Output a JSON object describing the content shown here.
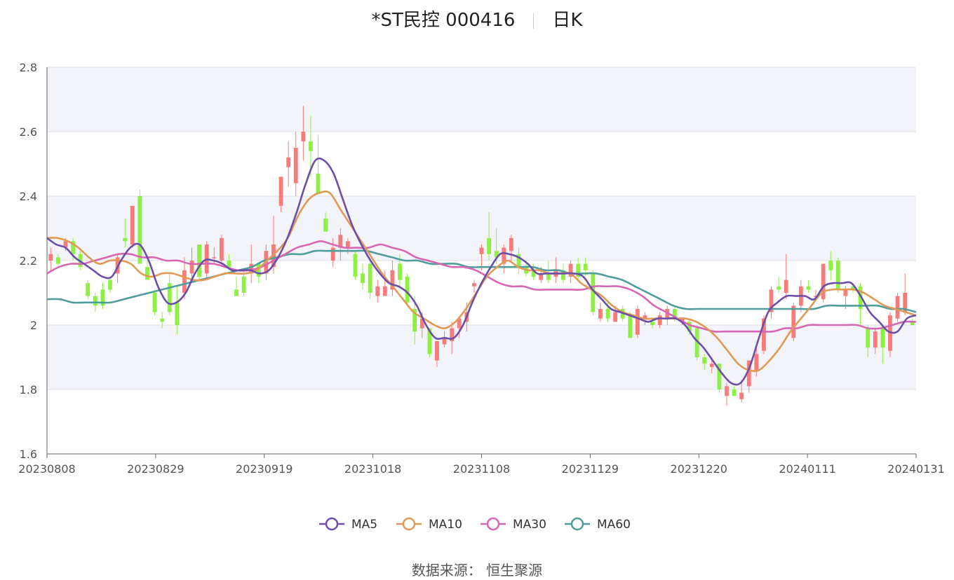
{
  "header": {
    "stock": "*ST民控 000416",
    "period": "日K"
  },
  "source": "数据来源： 恒生聚源",
  "colors": {
    "up": "#f87b7b",
    "down": "#8ef044",
    "ma5": "#6d4fa8",
    "ma10": "#e09a55",
    "ma30": "#d866b2",
    "ma60": "#4f9e9a",
    "grid": "#dde1ea",
    "band": "#f3f4f9"
  },
  "chart_data": {
    "type": "candlestick",
    "ylim": [
      1.6,
      2.8
    ],
    "yticks": [
      "1.6",
      "1.8",
      "2",
      "2.2",
      "2.4",
      "2.6",
      "2.8"
    ],
    "xticks": [
      "20230808",
      "20230829",
      "20230919",
      "20231018",
      "20231108",
      "20231129",
      "20231220",
      "20240111",
      "20240131"
    ],
    "legend": [
      "MA5",
      "MA10",
      "MA30",
      "MA60"
    ],
    "candles": [
      [
        2.2,
        2.22,
        2.17,
        2.24
      ],
      [
        2.21,
        2.19,
        2.18,
        2.22
      ],
      [
        2.24,
        2.26,
        2.23,
        2.27
      ],
      [
        2.26,
        2.22,
        2.2,
        2.27
      ],
      [
        2.22,
        2.18,
        2.17,
        2.23
      ],
      [
        2.13,
        2.09,
        2.08,
        2.14
      ],
      [
        2.09,
        2.06,
        2.04,
        2.1
      ],
      [
        2.11,
        2.06,
        2.05,
        2.13
      ],
      [
        2.14,
        2.11,
        2.1,
        2.15
      ],
      [
        2.16,
        2.21,
        2.13,
        2.22
      ],
      [
        2.27,
        2.26,
        2.24,
        2.33
      ],
      [
        2.25,
        2.37,
        2.24,
        2.37
      ],
      [
        2.4,
        2.19,
        2.19,
        2.42
      ],
      [
        2.18,
        2.14,
        2.14,
        2.2
      ],
      [
        2.1,
        2.04,
        2.03,
        2.11
      ],
      [
        2.02,
        2.01,
        1.99,
        2.04
      ],
      [
        2.13,
        2.04,
        2.03,
        2.16
      ],
      [
        2.07,
        2.0,
        1.97,
        2.12
      ],
      [
        2.1,
        2.17,
        2.08,
        2.21
      ],
      [
        2.16,
        2.2,
        2.14,
        2.24
      ],
      [
        2.25,
        2.15,
        2.14,
        2.25
      ],
      [
        2.16,
        2.25,
        2.14,
        2.26
      ],
      [
        2.21,
        2.21,
        2.19,
        2.24
      ],
      [
        2.2,
        2.27,
        2.18,
        2.28
      ],
      [
        2.2,
        2.18,
        2.17,
        2.22
      ],
      [
        2.11,
        2.09,
        2.09,
        2.15
      ],
      [
        2.15,
        2.1,
        2.09,
        2.17
      ],
      [
        2.16,
        2.19,
        2.13,
        2.25
      ],
      [
        2.19,
        2.15,
        2.13,
        2.19
      ],
      [
        2.16,
        2.23,
        2.14,
        2.25
      ],
      [
        2.18,
        2.25,
        2.16,
        2.34
      ],
      [
        2.37,
        2.46,
        2.35,
        2.46
      ],
      [
        2.49,
        2.52,
        2.43,
        2.57
      ],
      [
        2.44,
        2.55,
        2.4,
        2.6
      ],
      [
        2.57,
        2.6,
        2.51,
        2.68
      ],
      [
        2.57,
        2.54,
        2.46,
        2.65
      ],
      [
        2.47,
        2.41,
        2.41,
        2.59
      ],
      [
        2.33,
        2.29,
        2.29,
        2.35
      ],
      [
        2.2,
        2.24,
        2.18,
        2.27
      ],
      [
        2.24,
        2.28,
        2.2,
        2.3
      ],
      [
        2.24,
        2.26,
        2.22,
        2.27
      ],
      [
        2.22,
        2.15,
        2.14,
        2.23
      ],
      [
        2.16,
        2.13,
        2.11,
        2.19
      ],
      [
        2.19,
        2.1,
        2.08,
        2.2
      ],
      [
        2.09,
        2.12,
        2.07,
        2.14
      ],
      [
        2.09,
        2.12,
        2.09,
        2.17
      ],
      [
        2.11,
        2.17,
        2.09,
        2.2
      ],
      [
        2.19,
        2.14,
        2.12,
        2.22
      ],
      [
        2.15,
        2.07,
        2.06,
        2.16
      ],
      [
        2.05,
        1.98,
        1.94,
        2.09
      ],
      [
        1.99,
        2.02,
        1.96,
        2.04
      ],
      [
        1.99,
        1.91,
        1.9,
        1.99
      ],
      [
        1.89,
        1.95,
        1.87,
        1.95
      ],
      [
        1.94,
        1.96,
        1.93,
        1.98
      ],
      [
        1.95,
        1.99,
        1.91,
        2.01
      ],
      [
        1.99,
        2.02,
        1.96,
        2.02
      ],
      [
        2.01,
        2.04,
        1.98,
        2.07
      ],
      [
        2.12,
        2.13,
        2.1,
        2.14
      ],
      [
        2.22,
        2.24,
        2.17,
        2.25
      ],
      [
        2.27,
        2.22,
        2.2,
        2.35
      ],
      [
        2.23,
        2.21,
        2.19,
        2.3
      ],
      [
        2.19,
        2.24,
        2.16,
        2.25
      ],
      [
        2.23,
        2.27,
        2.2,
        2.28
      ],
      [
        2.22,
        2.18,
        2.16,
        2.24
      ],
      [
        2.18,
        2.16,
        2.15,
        2.2
      ],
      [
        2.17,
        2.15,
        2.14,
        2.19
      ],
      [
        2.14,
        2.16,
        2.13,
        2.18
      ],
      [
        2.16,
        2.14,
        2.13,
        2.2
      ],
      [
        2.15,
        2.17,
        2.13,
        2.21
      ],
      [
        2.17,
        2.14,
        2.13,
        2.19
      ],
      [
        2.15,
        2.19,
        2.13,
        2.2
      ],
      [
        2.19,
        2.15,
        2.14,
        2.21
      ],
      [
        2.19,
        2.17,
        2.15,
        2.21
      ],
      [
        2.16,
        2.04,
        2.03,
        2.17
      ],
      [
        2.02,
        2.05,
        2.01,
        2.07
      ],
      [
        2.05,
        2.02,
        2.01,
        2.07
      ],
      [
        2.01,
        2.04,
        2.01,
        2.06
      ],
      [
        2.05,
        2.02,
        2.01,
        2.06
      ],
      [
        2.03,
        1.96,
        1.96,
        2.04
      ],
      [
        1.97,
        2.05,
        1.96,
        2.06
      ],
      [
        2.02,
        2.03,
        2.0,
        2.04
      ],
      [
        2.01,
        2.0,
        1.99,
        2.02
      ],
      [
        2.0,
        2.03,
        1.99,
        2.04
      ],
      [
        2.02,
        2.05,
        2.0,
        2.06
      ],
      [
        2.05,
        2.02,
        2.01,
        2.06
      ],
      [
        2.01,
        2.02,
        2.0,
        2.02
      ],
      [
        2.01,
        1.98,
        1.97,
        2.02
      ],
      [
        1.99,
        1.9,
        1.89,
        2.0
      ],
      [
        1.9,
        1.88,
        1.86,
        1.91
      ],
      [
        1.87,
        1.88,
        1.85,
        1.9
      ],
      [
        1.88,
        1.8,
        1.79,
        1.88
      ],
      [
        1.78,
        1.81,
        1.75,
        1.82
      ],
      [
        1.8,
        1.78,
        1.78,
        1.81
      ],
      [
        1.77,
        1.79,
        1.76,
        1.83
      ],
      [
        1.81,
        1.89,
        1.79,
        1.89
      ],
      [
        1.86,
        1.91,
        1.84,
        1.93
      ],
      [
        1.92,
        2.02,
        1.91,
        2.03
      ],
      [
        2.04,
        2.11,
        2.02,
        2.12
      ],
      [
        2.12,
        2.11,
        2.1,
        2.15
      ],
      [
        2.1,
        2.14,
        2.08,
        2.22
      ],
      [
        1.96,
        2.06,
        1.95,
        2.07
      ],
      [
        2.06,
        2.12,
        2.04,
        2.14
      ],
      [
        2.12,
        2.11,
        2.1,
        2.14
      ],
      [
        2.09,
        2.09,
        2.08,
        2.11
      ],
      [
        2.08,
        2.19,
        2.07,
        2.19
      ],
      [
        2.2,
        2.17,
        2.14,
        2.23
      ],
      [
        2.2,
        2.11,
        2.1,
        2.21
      ],
      [
        2.09,
        2.11,
        2.05,
        2.12
      ],
      [
        2.12,
        2.11,
        2.1,
        2.13
      ],
      [
        2.12,
        2.05,
        2.0,
        2.13
      ],
      [
        1.99,
        1.93,
        1.9,
        2.0
      ],
      [
        1.93,
        1.98,
        1.91,
        1.99
      ],
      [
        1.99,
        1.93,
        1.88,
        2.0
      ],
      [
        1.92,
        2.03,
        1.9,
        2.04
      ],
      [
        2.02,
        2.09,
        2.01,
        2.1
      ],
      [
        2.04,
        2.1,
        2.03,
        2.16
      ],
      [
        2.01,
        2.0,
        2.0,
        2.02
      ]
    ],
    "ma5": [
      2.27,
      2.25,
      2.24,
      2.21,
      2.19,
      2.17,
      2.15,
      2.15,
      2.2,
      2.24,
      2.25,
      2.2,
      2.12,
      2.07,
      2.07,
      2.1,
      2.16,
      2.2,
      2.2,
      2.19,
      2.17,
      2.17,
      2.17,
      2.16,
      2.17,
      2.21,
      2.27,
      2.35,
      2.44,
      2.51,
      2.51,
      2.47,
      2.39,
      2.31,
      2.25,
      2.2,
      2.16,
      2.13,
      2.12,
      2.1,
      2.06,
      2.0,
      1.96,
      1.96,
      1.96,
      2.0,
      2.07,
      2.13,
      2.18,
      2.22,
      2.22,
      2.21,
      2.19,
      2.16,
      2.16,
      2.16,
      2.16,
      2.16,
      2.15,
      2.11,
      2.08,
      2.05,
      2.04,
      2.03,
      2.02,
      2.01,
      2.02,
      2.02,
      2.02,
      2.0,
      1.96,
      1.93,
      1.89,
      1.85,
      1.82,
      1.82,
      1.87,
      1.96,
      2.04,
      2.07,
      2.09,
      2.09,
      2.09,
      2.08,
      2.12,
      2.13,
      2.13,
      2.13,
      2.09,
      2.04,
      2.01,
      1.98,
      1.98,
      2.02,
      2.03
    ],
    "ma10": [
      2.27,
      2.27,
      2.26,
      2.24,
      2.21,
      2.19,
      2.2,
      2.2,
      2.19,
      2.16,
      2.15,
      2.16,
      2.16,
      2.15,
      2.14,
      2.14,
      2.15,
      2.16,
      2.16,
      2.16,
      2.17,
      2.2,
      2.23,
      2.27,
      2.34,
      2.39,
      2.41,
      2.41,
      2.36,
      2.31,
      2.26,
      2.21,
      2.16,
      2.12,
      2.08,
      2.04,
      2.02,
      2.0,
      1.99,
      2.01,
      2.05,
      2.1,
      2.15,
      2.18,
      2.2,
      2.18,
      2.17,
      2.17,
      2.16,
      2.16,
      2.16,
      2.13,
      2.11,
      2.09,
      2.06,
      2.04,
      2.03,
      2.02,
      2.02,
      2.02,
      2.02,
      2.02,
      2.01,
      1.99,
      1.96,
      1.92,
      1.88,
      1.86,
      1.86,
      1.89,
      1.93,
      1.98,
      2.02,
      2.06,
      2.1,
      2.11,
      2.11,
      2.11,
      2.1,
      2.08,
      2.06,
      2.05,
      2.04,
      2.03
    ],
    "ma30": [
      2.16,
      2.18,
      2.19,
      2.19,
      2.2,
      2.21,
      2.22,
      2.22,
      2.21,
      2.21,
      2.2,
      2.2,
      2.19,
      2.19,
      2.19,
      2.18,
      2.17,
      2.17,
      2.18,
      2.2,
      2.22,
      2.24,
      2.25,
      2.26,
      2.25,
      2.24,
      2.24,
      2.24,
      2.25,
      2.24,
      2.23,
      2.21,
      2.2,
      2.19,
      2.18,
      2.18,
      2.17,
      2.15,
      2.13,
      2.12,
      2.12,
      2.11,
      2.11,
      2.11,
      2.11,
      2.11,
      2.12,
      2.12,
      2.12,
      2.11,
      2.09,
      2.06,
      2.04,
      2.02,
      2.0,
      1.99,
      1.98,
      1.98,
      1.98,
      1.98,
      1.98,
      1.98,
      1.99,
      1.99,
      2.0,
      2.0,
      2.0,
      2.0,
      2.0,
      1.99,
      1.99,
      2.0,
      2.01,
      2.01
    ],
    "ma60": [
      2.08,
      2.08,
      2.07,
      2.07,
      2.07,
      2.07,
      2.08,
      2.09,
      2.1,
      2.11,
      2.12,
      2.13,
      2.14,
      2.15,
      2.16,
      2.17,
      2.18,
      2.2,
      2.21,
      2.22,
      2.22,
      2.23,
      2.23,
      2.23,
      2.23,
      2.23,
      2.22,
      2.21,
      2.2,
      2.2,
      2.19,
      2.19,
      2.19,
      2.18,
      2.18,
      2.18,
      2.18,
      2.18,
      2.18,
      2.17,
      2.17,
      2.16,
      2.16,
      2.16,
      2.15,
      2.14,
      2.12,
      2.1,
      2.08,
      2.06,
      2.05,
      2.05,
      2.05,
      2.05,
      2.05,
      2.05,
      2.05,
      2.05,
      2.05,
      2.05,
      2.05,
      2.06,
      2.06,
      2.06,
      2.06,
      2.06,
      2.05,
      2.05,
      2.04
    ]
  }
}
